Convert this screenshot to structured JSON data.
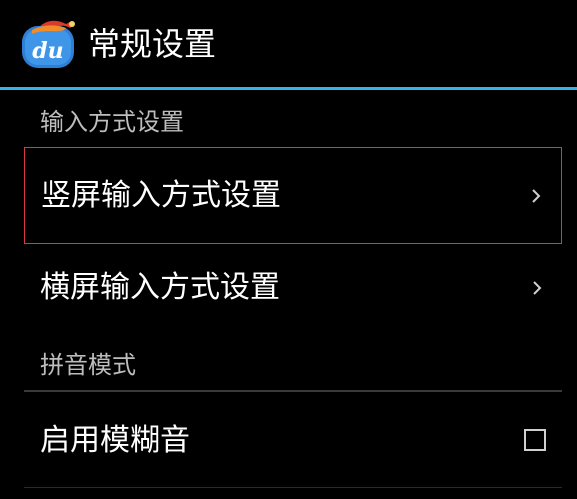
{
  "app": {
    "title": "常规设置",
    "icon": "du-logo-icon",
    "icon_text": "du"
  },
  "colors": {
    "accent": "#33b5e5",
    "focus_border": "#d9393f",
    "category_text": "#bdbdbd"
  },
  "sections": [
    {
      "category": "输入方式设置",
      "items": [
        {
          "title": "竖屏输入方式设置",
          "widget": "chevron-right-icon",
          "focused": true
        },
        {
          "title": "横屏输入方式设置",
          "widget": "chevron-right-icon"
        }
      ]
    },
    {
      "category": "拼音模式",
      "items": [
        {
          "title": "启用模糊音",
          "widget": "checkbox",
          "checked": false
        }
      ]
    }
  ]
}
